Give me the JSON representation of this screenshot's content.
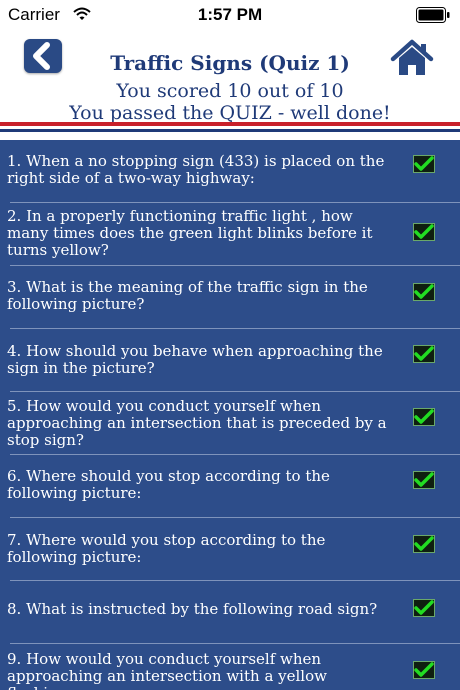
{
  "status_bar": {
    "carrier": "Carrier",
    "time": "1:57 PM"
  },
  "header": {
    "back_icon": "chevron-left-icon",
    "home_icon": "home-icon",
    "title": "Traffic Signs (Quiz 1)",
    "score_text": "You scored 10 out of 10",
    "passed_text": "You passed the QUIZ - well done!"
  },
  "colors": {
    "brand_navy": "#1f3a78",
    "list_background": "#2d4d8a",
    "stripe_red": "#c8202a",
    "check_green": "#1fd21f"
  },
  "questions": [
    {
      "text": "1. When a no stopping sign (433) is placed on the right side of a two-way highway:",
      "status_icon": "check-icon"
    },
    {
      "text": "2. In a properly functioning traffic light , how many times does the green light blinks before it turns yellow?",
      "status_icon": "check-icon"
    },
    {
      "text": "3. What is the meaning of the traffic sign in the following picture?",
      "status_icon": "check-icon"
    },
    {
      "text": "4. How should you behave when approaching the sign in the picture?",
      "status_icon": "check-icon"
    },
    {
      "text": "5. How would you conduct yourself when approaching an intersection that is preceded by a stop sign?",
      "status_icon": "check-icon"
    },
    {
      "text": "6. Where should you stop according to the following picture:",
      "status_icon": "check-icon"
    },
    {
      "text": "7. Where would you stop according to the following picture:",
      "status_icon": "check-icon"
    },
    {
      "text": "8. What is instructed by the following road sign?",
      "status_icon": "check-icon"
    },
    {
      "text": "9. How would you conduct yourself when approaching an intersection with a yellow flashing",
      "status_icon": "check-icon"
    }
  ]
}
